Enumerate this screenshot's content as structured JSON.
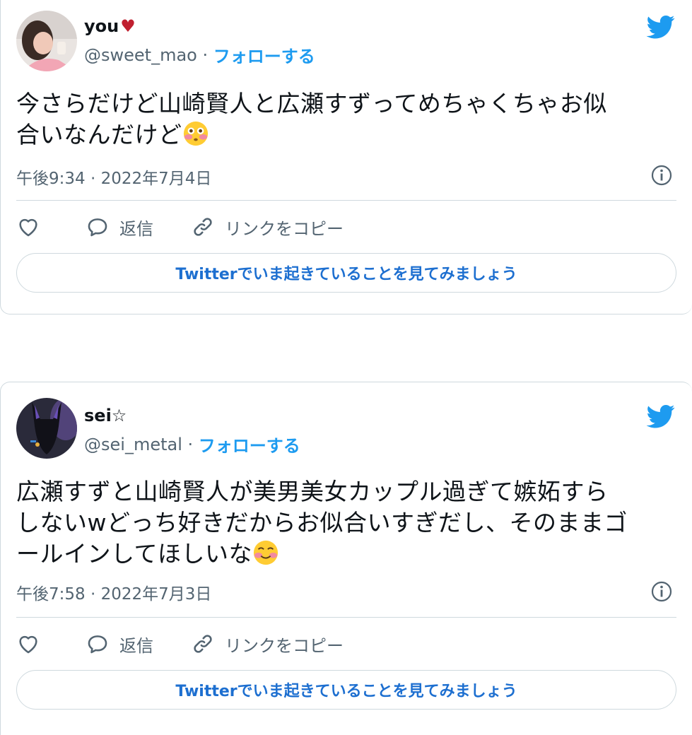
{
  "tweets": [
    {
      "name": "you",
      "name_suffix": "♥",
      "handle": "@sweet_mao",
      "separator": " · ",
      "follow_label": "フォローする",
      "text_line1": "今さらだけど山崎賢人と広瀬すずってめちゃくちゃお似",
      "text_line2": "合いなんだけど",
      "text_emoji": "flushed-face",
      "timestamp": "午後9:34 · 2022年7月4日",
      "reply_label": "返信",
      "copy_link_label": "リンクをコピー",
      "cta_label": "Twitterでいま起きていることを見てみましょう"
    },
    {
      "name": "sei☆",
      "handle": "@sei_metal",
      "separator": " · ",
      "follow_label": "フォローする",
      "text_line1": "広瀬すずと山崎賢人が美男美女カップル過ぎて嫉妬すら",
      "text_line2": "しないwどっち好きだからお似合いすぎだし、そのままゴ",
      "text_line3": "ールインしてほしいな",
      "text_emoji": "smiling-face",
      "timestamp": "午後7:58 · 2022年7月3日",
      "reply_label": "返信",
      "copy_link_label": "リンクをコピー",
      "cta_label": "Twitterでいま起きていることを見てみましょう"
    }
  ],
  "colors": {
    "twitter_blue": "#1d9bf0",
    "secondary_text": "#536471",
    "border": "#cfd9de",
    "heart_red": "#c01f2f"
  },
  "icons": [
    "twitter-bird-icon",
    "info-icon",
    "heart-icon",
    "reply-icon",
    "link-icon",
    "flushed-face-emoji",
    "smiling-face-emoji"
  ]
}
